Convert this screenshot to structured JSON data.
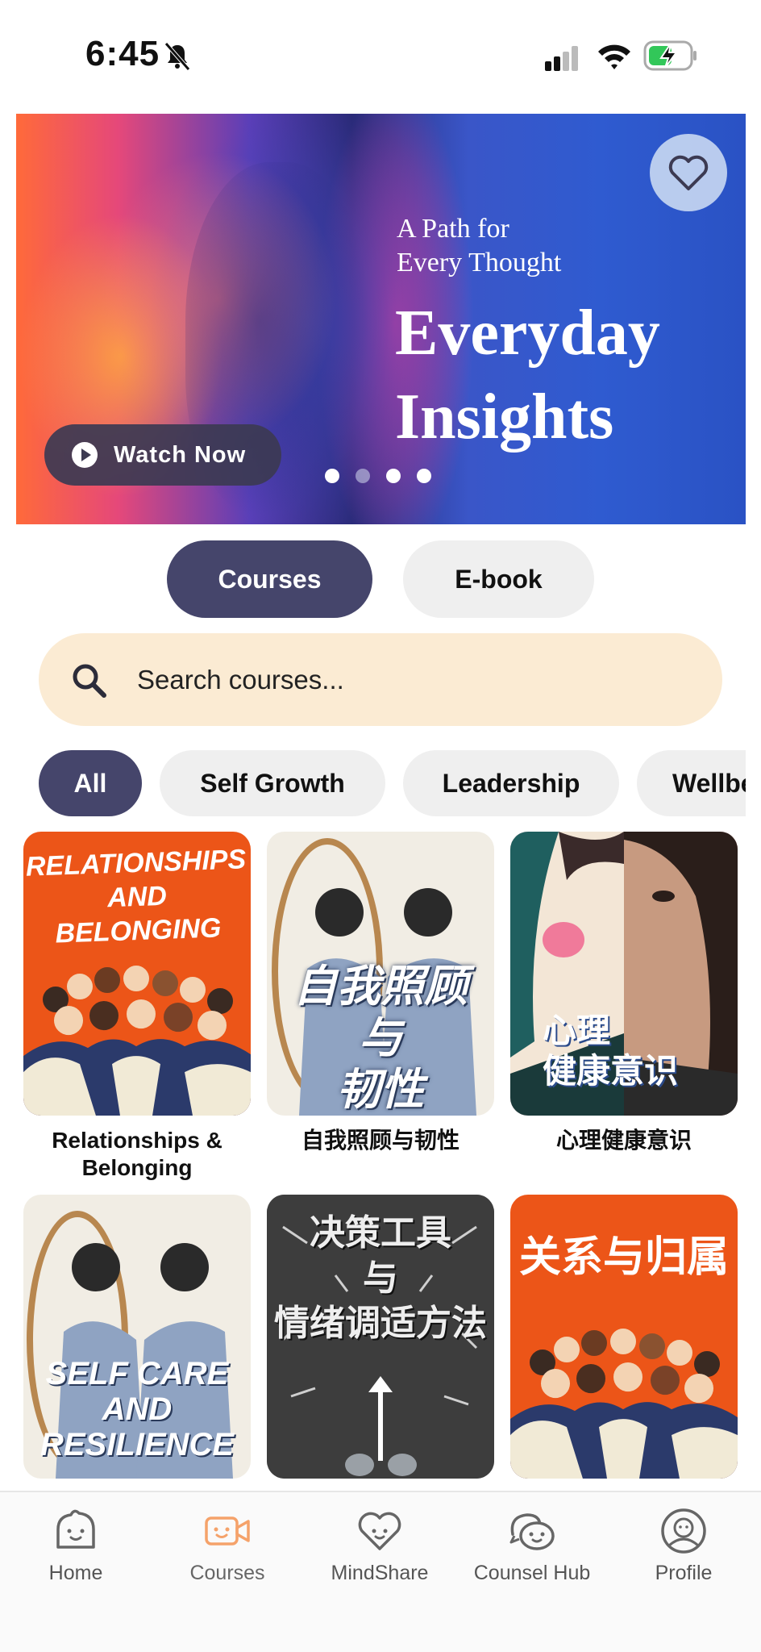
{
  "status_bar": {
    "time": "6:45"
  },
  "hero": {
    "subtitle": "A Path for\nEvery Thought",
    "title": "Everyday\nInsights",
    "watch_label": "Watch Now",
    "slides": 4,
    "active_slide": 3
  },
  "segments": [
    {
      "label": "Courses",
      "active": true
    },
    {
      "label": "E-book",
      "active": false
    }
  ],
  "search": {
    "placeholder": "Search courses..."
  },
  "categories": [
    {
      "label": "All",
      "active": true
    },
    {
      "label": "Self Growth",
      "active": false
    },
    {
      "label": "Leadership",
      "active": false
    },
    {
      "label": "Wellbeing",
      "active": false
    }
  ],
  "courses": [
    {
      "title": "Relationships & Belonging",
      "art_text": "RELATIONSHIPS\nAND\nBELONGING"
    },
    {
      "title": "自我照顾与韧性",
      "art_text": "自我照顾\n与\n韧性"
    },
    {
      "title": "心理健康意识",
      "art_text": "心理\n健康意识"
    },
    {
      "title": "",
      "art_text": "SELF CARE\nAND\nRESILIENCE"
    },
    {
      "title": "",
      "art_text": "决策工具\n与\n情绪调适方法"
    },
    {
      "title": "",
      "art_text": "关系与归属"
    }
  ],
  "tabbar": [
    {
      "label": "Home",
      "icon": "home-face-icon",
      "active": false
    },
    {
      "label": "Courses",
      "icon": "video-camera-icon",
      "active": true
    },
    {
      "label": "MindShare",
      "icon": "heart-icon",
      "active": false
    },
    {
      "label": "Counsel Hub",
      "icon": "chat-bubbles-icon",
      "active": false
    },
    {
      "label": "Profile",
      "icon": "profile-icon",
      "active": false
    }
  ],
  "colors": {
    "primary": "#45456b",
    "chip_bg": "#efefef",
    "search_bg": "#fbebd3",
    "accent_orange": "#f5a26a"
  }
}
